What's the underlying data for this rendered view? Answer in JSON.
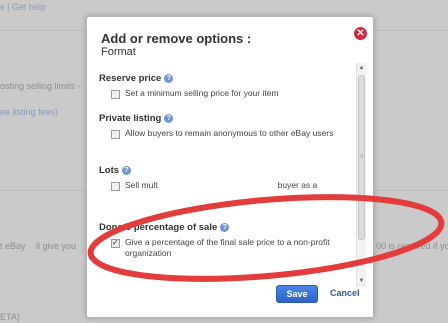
{
  "background": {
    "top_links": "s | Get help",
    "left_line1": "osting selling limits -",
    "left_line2": "ee listing fees)",
    "left_line3": "t eBay",
    "left_line3b": "ll give you",
    "right_line3": "00 is required if you",
    "bottom_left": "ETA)"
  },
  "modal": {
    "title": "Add or remove options :",
    "subtitle": "Format",
    "close_icon": "close-circle-icon",
    "options": [
      {
        "title": "Reserve price",
        "label": "Set a minimum selling price for your item",
        "checked": false
      },
      {
        "title": "Private listing",
        "label": "Allow buyers to remain anonymous to other eBay users",
        "checked": false
      },
      {
        "title": "Lots",
        "label_visible_start": "Sell mult",
        "label_visible_end": "buyer as a",
        "checked": false
      },
      {
        "title": "Donate percentage of sale",
        "label": "Give a percentage of the final sale price to a non-profit organization",
        "checked": true
      }
    ],
    "save_label": "Save",
    "cancel_label": "Cancel"
  },
  "colors": {
    "close_red": "#d7263d",
    "save_blue": "#2c65c7",
    "annotation_red": "#e43b3b"
  }
}
